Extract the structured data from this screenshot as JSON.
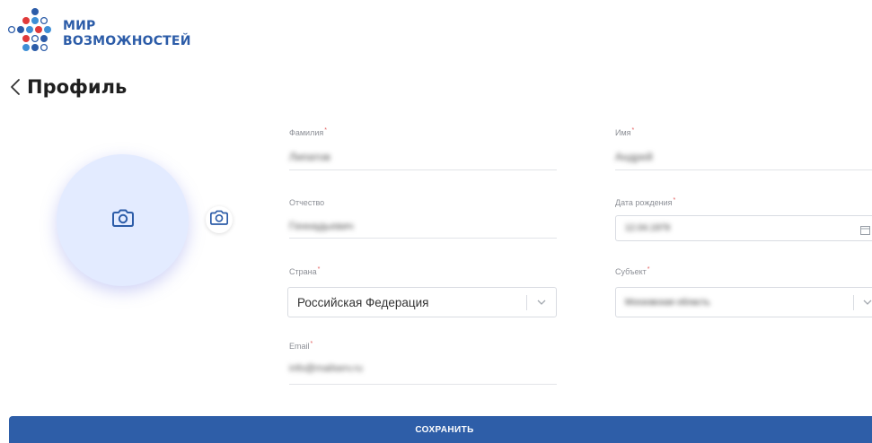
{
  "brand": {
    "line1": "МИР",
    "line2": "ВОЗМОЖНОСТЕЙ",
    "colors": {
      "red": "#e03a3a",
      "blue": "#2c5ca8",
      "light_blue": "#3e8fd6"
    }
  },
  "header": {
    "back_icon": "chevron-left-icon",
    "title": "Профиль"
  },
  "avatar": {
    "camera_icon": "camera-icon",
    "upload_icon": "camera-icon"
  },
  "form": {
    "last_name": {
      "label": "Фамилия",
      "value": "Липатов"
    },
    "first_name": {
      "label": "Имя",
      "value": "Андрей"
    },
    "patronymic": {
      "label": "Отчество",
      "value": "Геннадьевич"
    },
    "birth_date": {
      "label": "Дата рождения",
      "value": "12.04.1979"
    },
    "country": {
      "label": "Страна",
      "value": "Российская Федерация"
    },
    "region": {
      "label": "Субъект",
      "value": "Московская область"
    },
    "email": {
      "label": "Email",
      "value": "info@mailserv.ru"
    }
  },
  "actions": {
    "save_label": "СОХРАНИТЬ",
    "accent": "#2e5ea8"
  }
}
